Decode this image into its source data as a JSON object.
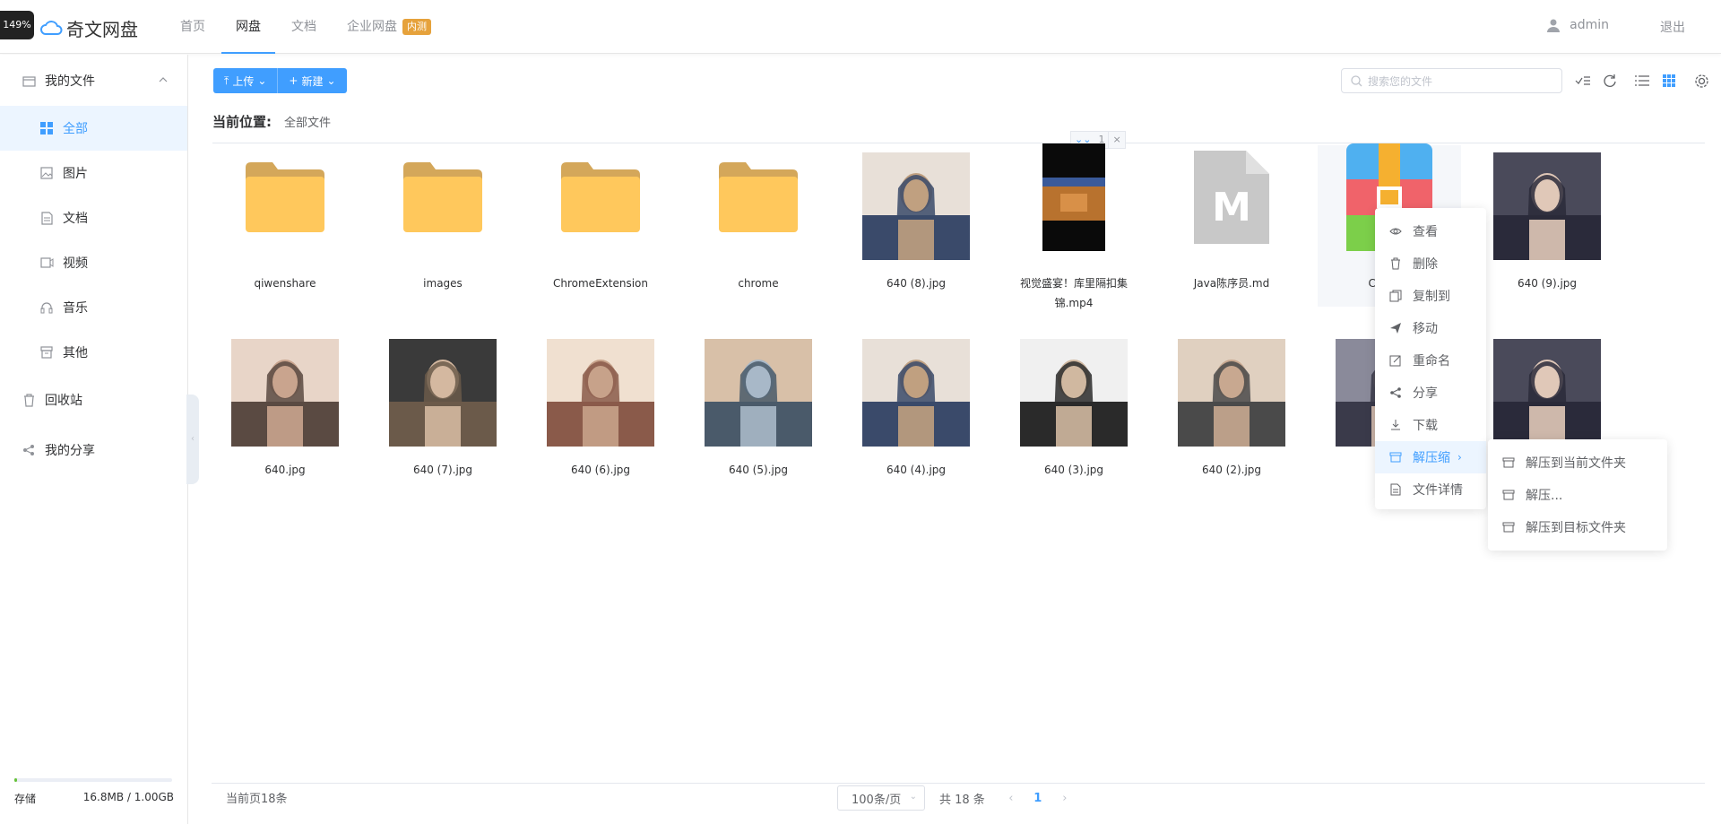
{
  "zoom": "149%",
  "header": {
    "brand": "奇文网盘",
    "nav": [
      {
        "label": "首页"
      },
      {
        "label": "网盘"
      },
      {
        "label": "文档"
      },
      {
        "label": "企业网盘",
        "badge": "内测"
      }
    ],
    "user": "admin",
    "logout": "退出"
  },
  "sidebar": {
    "my_files": "我的文件",
    "items": [
      {
        "label": "全部",
        "icon": "grid-icon"
      },
      {
        "label": "图片",
        "icon": "image-icon"
      },
      {
        "label": "文档",
        "icon": "document-icon"
      },
      {
        "label": "视频",
        "icon": "video-icon"
      },
      {
        "label": "音乐",
        "icon": "headphones-icon"
      },
      {
        "label": "其他",
        "icon": "box-icon"
      }
    ],
    "recycle": "回收站",
    "share": "我的分享",
    "storage": {
      "label": "存储",
      "value": "16.8MB / 1.00GB",
      "used_fraction": 0.016
    }
  },
  "toolbar": {
    "upload": "上传",
    "create": "新建",
    "search_placeholder": "搜索您的文件"
  },
  "breadcrumb": {
    "label": "当前位置:",
    "path": "全部文件"
  },
  "selection": {
    "count": "1"
  },
  "files": [
    {
      "name": "qiwenshare",
      "type": "folder"
    },
    {
      "name": "images",
      "type": "folder"
    },
    {
      "name": "ChromeExtension",
      "type": "folder"
    },
    {
      "name": "chrome",
      "type": "folder"
    },
    {
      "name": "640 (8).jpg",
      "type": "image"
    },
    {
      "name": "视觉盛宴！库里隔扣集锦.mp4",
      "type": "video"
    },
    {
      "name": "Java陈序员.md",
      "type": "markdown"
    },
    {
      "name": "Chrome",
      "type": "archive"
    },
    {
      "name": "640 (9).jpg",
      "type": "image"
    },
    {
      "name": "640.jpg",
      "type": "image"
    },
    {
      "name": "640 (7).jpg",
      "type": "image"
    },
    {
      "name": "640 (6).jpg",
      "type": "image"
    },
    {
      "name": "640 (5).jpg",
      "type": "image"
    },
    {
      "name": "640 (4).jpg",
      "type": "image"
    },
    {
      "name": "640 (3).jpg",
      "type": "image"
    },
    {
      "name": "640 (2).jpg",
      "type": "image"
    },
    {
      "name": "64",
      "type": "image"
    },
    {
      "name": "",
      "type": "image"
    }
  ],
  "context_menu": {
    "items": [
      {
        "label": "查看",
        "icon": "eye-icon"
      },
      {
        "label": "删除",
        "icon": "trash-icon"
      },
      {
        "label": "复制到",
        "icon": "copy-icon"
      },
      {
        "label": "移动",
        "icon": "send-icon"
      },
      {
        "label": "重命名",
        "icon": "edit-icon"
      },
      {
        "label": "分享",
        "icon": "share-icon"
      },
      {
        "label": "下载",
        "icon": "download-icon"
      },
      {
        "label": "解压缩",
        "icon": "box-icon"
      },
      {
        "label": "文件详情",
        "icon": "file-icon"
      }
    ],
    "submenu": [
      {
        "label": "解压到当前文件夹"
      },
      {
        "label": "解压..."
      },
      {
        "label": "解压到目标文件夹"
      }
    ]
  },
  "pagination": {
    "current_page_count": "当前页18条",
    "page_size": "100条/页",
    "total": "共 18 条",
    "page": "1"
  },
  "colors": {
    "primary": "#409eff",
    "folder": "#ffc85c",
    "badge": "#e6a23c"
  }
}
